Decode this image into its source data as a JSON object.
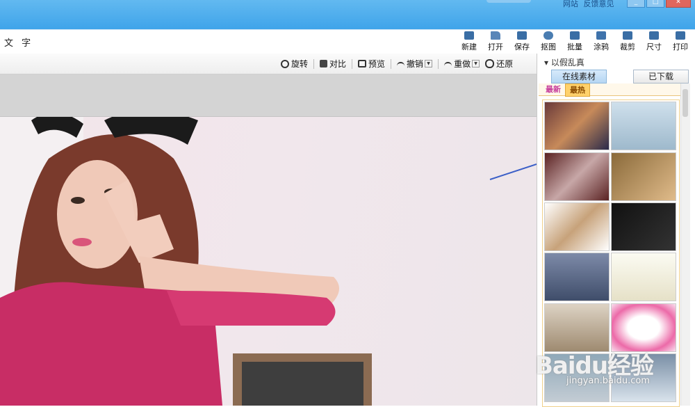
{
  "titlebar": {
    "links": [
      "网站",
      "反馈意见"
    ]
  },
  "menu": {
    "text": "文 字"
  },
  "main_toolbar": [
    {
      "label": "新建",
      "icon": "new-file-icon"
    },
    {
      "label": "打开",
      "icon": "folder-icon"
    },
    {
      "label": "保存",
      "icon": "save-icon"
    },
    {
      "label": "抠图",
      "icon": "cutout-icon"
    },
    {
      "label": "批量",
      "icon": "batch-gear-icon"
    },
    {
      "label": "涂鸦",
      "icon": "paint-icon"
    },
    {
      "label": "裁剪",
      "icon": "crop-icon"
    },
    {
      "label": "尺寸",
      "icon": "resize-icon"
    },
    {
      "label": "打印",
      "icon": "printer-icon"
    }
  ],
  "edit_toolbar": {
    "rotate": "旋转",
    "compare": "对比",
    "preview": "预览",
    "undo": "撤销",
    "redo": "重做",
    "restore": "还原"
  },
  "right_panel": {
    "title": "以假乱真",
    "tabs": [
      "在线素材",
      "已下载"
    ],
    "filters": [
      "最新",
      "最热"
    ]
  },
  "watermark": {
    "main": "Baidu经验",
    "sub": "jingyan.baidu.com"
  }
}
